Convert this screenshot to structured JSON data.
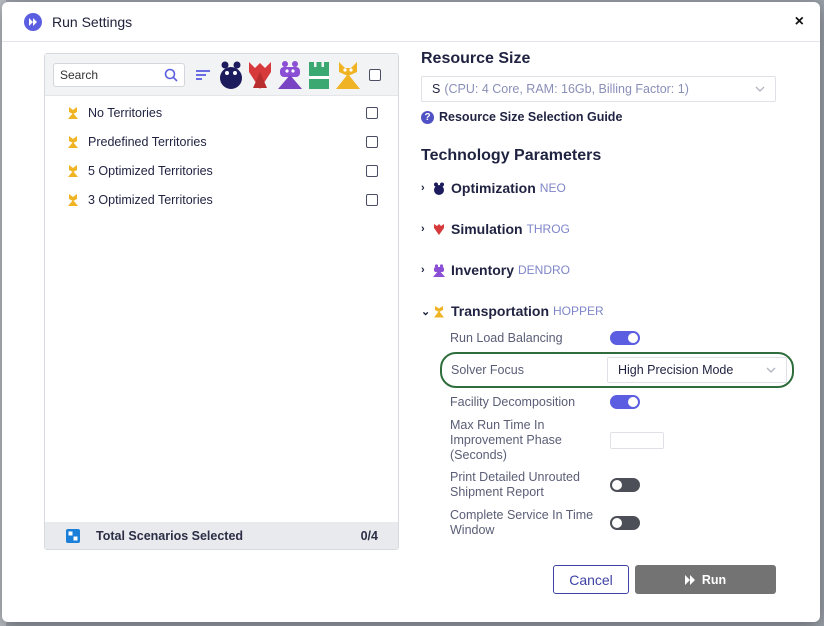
{
  "dialog": {
    "title": "Run Settings",
    "close_label": "×"
  },
  "left": {
    "search_placeholder": "Search",
    "engine_icons": [
      "neo-icon",
      "throg-icon",
      "dendro-icon",
      "triad-icon",
      "hopper-icon"
    ],
    "items": [
      {
        "label": "No Territories"
      },
      {
        "label": "Predefined Territories"
      },
      {
        "label": "5 Optimized Territories"
      },
      {
        "label": "3 Optimized Territories"
      }
    ],
    "footer_label": "Total Scenarios Selected",
    "footer_count": "0/4"
  },
  "resource": {
    "title": "Resource Size",
    "size": "S",
    "detail": "(CPU: 4 Core, RAM: 16Gb, Billing Factor: 1)",
    "guide": "Resource Size Selection Guide"
  },
  "tech": {
    "title": "Technology Parameters",
    "params": [
      {
        "caret": "›",
        "name": "Optimization",
        "engine": "NEO",
        "color": "#1b1b5e"
      },
      {
        "caret": "›",
        "name": "Simulation",
        "engine": "THROG",
        "color": "#d63a3a"
      },
      {
        "caret": "›",
        "name": "Inventory",
        "engine": "DENDRO",
        "color": "#8b4fd6"
      },
      {
        "caret": "⌄",
        "name": "Transportation",
        "engine": "HOPPER",
        "color": "#f0b323"
      }
    ],
    "transport_settings": {
      "run_load_balancing": {
        "label": "Run Load Balancing",
        "on": true
      },
      "solver_focus": {
        "label": "Solver Focus",
        "value": "High Precision Mode"
      },
      "facility_decomposition": {
        "label": "Facility Decomposition",
        "on": true
      },
      "max_run_time": {
        "label": "Max Run Time In Improvement Phase (Seconds)",
        "value": ""
      },
      "print_unrouted": {
        "label": "Print Detailed Unrouted Shipment Report",
        "on": false
      },
      "complete_service": {
        "label": "Complete Service In Time Window",
        "on": false
      }
    }
  },
  "buttons": {
    "cancel": "Cancel",
    "run": "Run"
  },
  "colors": {
    "accent": "#5b5ee0",
    "highlight_ring": "#2f6e3c",
    "run_disabled": "#737373"
  }
}
